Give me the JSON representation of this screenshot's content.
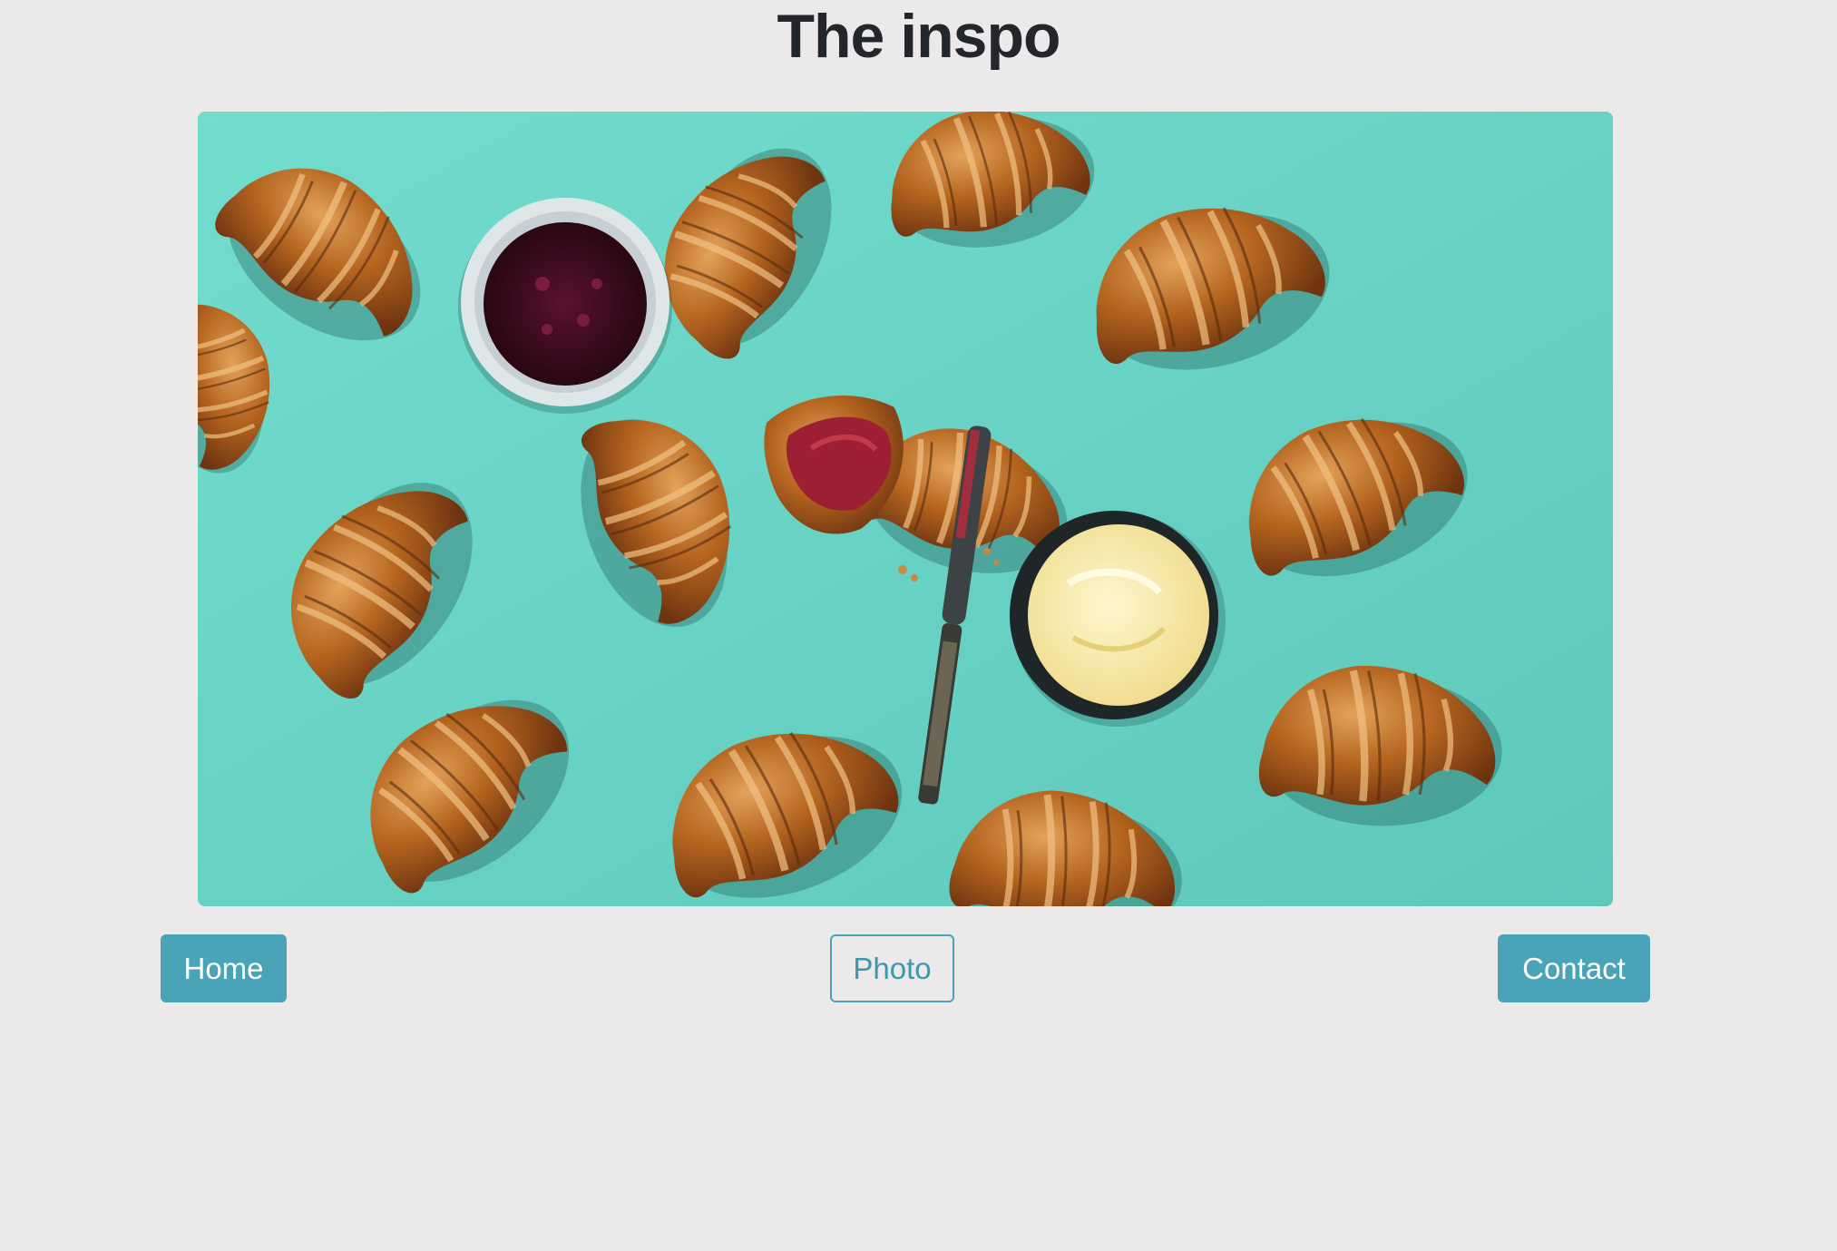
{
  "page": {
    "title": "The inspo"
  },
  "hero_image": {
    "alt": "Croissants with jam and butter on a teal background"
  },
  "nav": {
    "home_label": "Home",
    "photo_label": "Photo",
    "contact_label": "Contact"
  },
  "colors": {
    "background": "#ebe9e9",
    "accent": "#48a4b6",
    "title_text": "#23262b",
    "image_backdrop": "#67d1c4"
  }
}
